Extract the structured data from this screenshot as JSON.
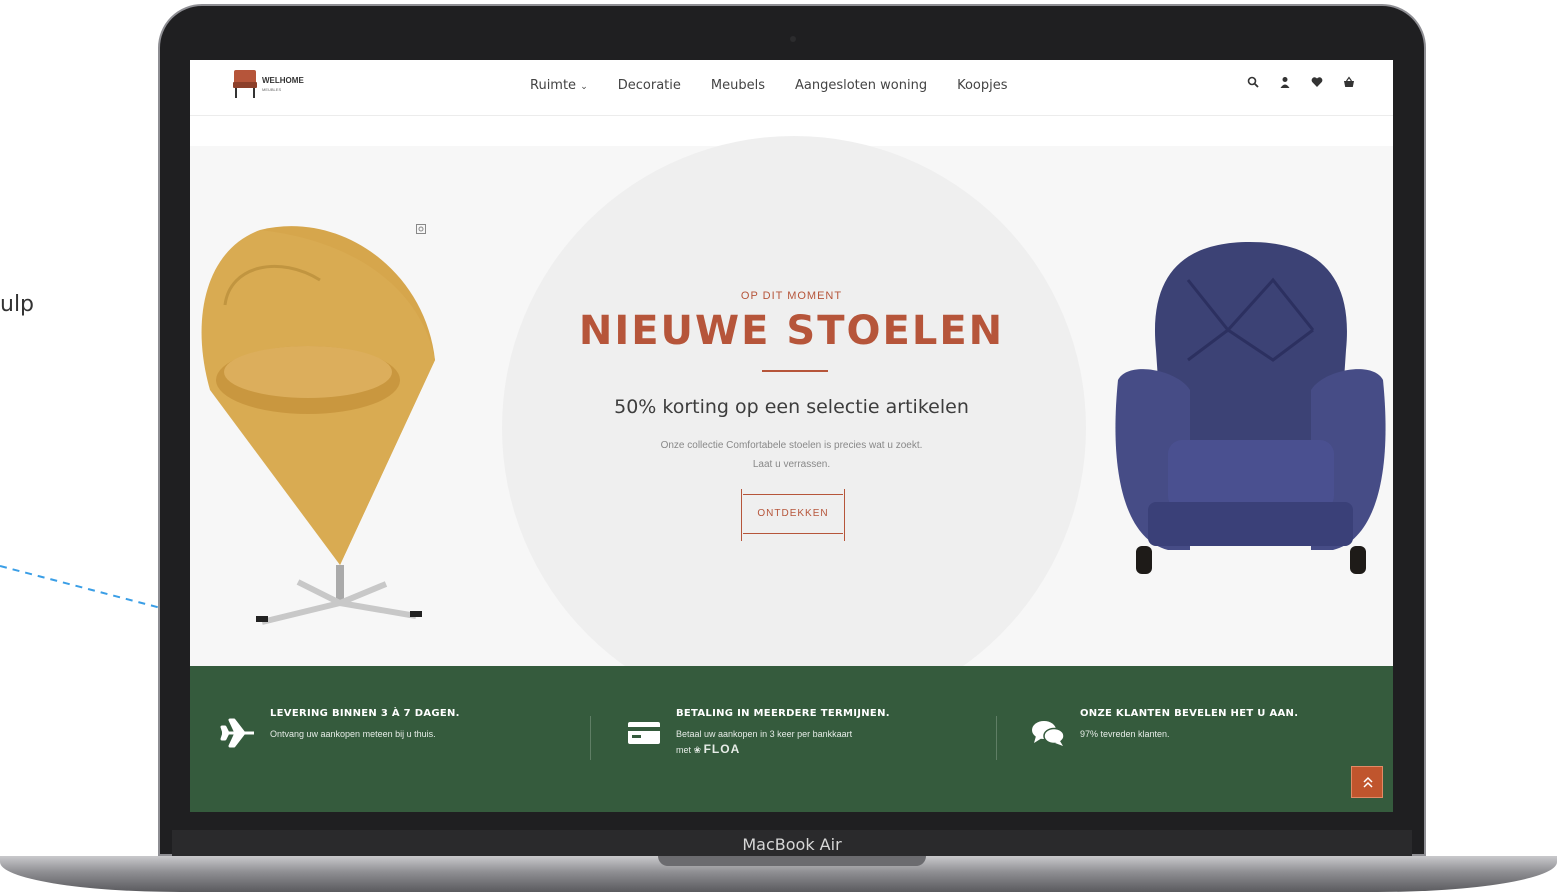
{
  "page": {
    "side_text": "ulp",
    "device_label": "MacBook Air"
  },
  "header": {
    "logo_text": "WELHOME",
    "logo_sub": "MEUBLES",
    "nav": [
      "Ruimte",
      "Decoratie",
      "Meubels",
      "Aangesloten woning",
      "Koopjes"
    ],
    "icons": [
      "search-icon",
      "user-icon",
      "heart-icon",
      "basket-icon"
    ]
  },
  "hero": {
    "eyebrow": "OP DIT MOMENT",
    "title": "NIEUWE STOELEN",
    "subtitle": "50% korting op een selectie artikelen",
    "desc_line1": "Onze collectie Comfortabele stoelen is precies wat u zoekt.",
    "desc_line2": "Laat u verrassen.",
    "cta": "ONTDEKKEN"
  },
  "features": [
    {
      "icon": "plane-icon",
      "title": "LEVERING BINNEN 3 À 7 DAGEN.",
      "text": "Ontvang uw aankopen meteen bij u thuis."
    },
    {
      "icon": "credit-card-icon",
      "title": "BETALING IN MEERDERE TERMIJNEN.",
      "text": "Betaal uw aankopen in 3 keer per bankkaart",
      "text2": "met",
      "brand": "FLOA"
    },
    {
      "icon": "chat-bubbles-icon",
      "title": "ONZE KLANTEN BEVELEN HET U AAN.",
      "text": "97% tevreden klanten."
    }
  ],
  "colors": {
    "accent": "#b6553a",
    "band_green": "#355b3d",
    "to_top": "#c0552d"
  }
}
